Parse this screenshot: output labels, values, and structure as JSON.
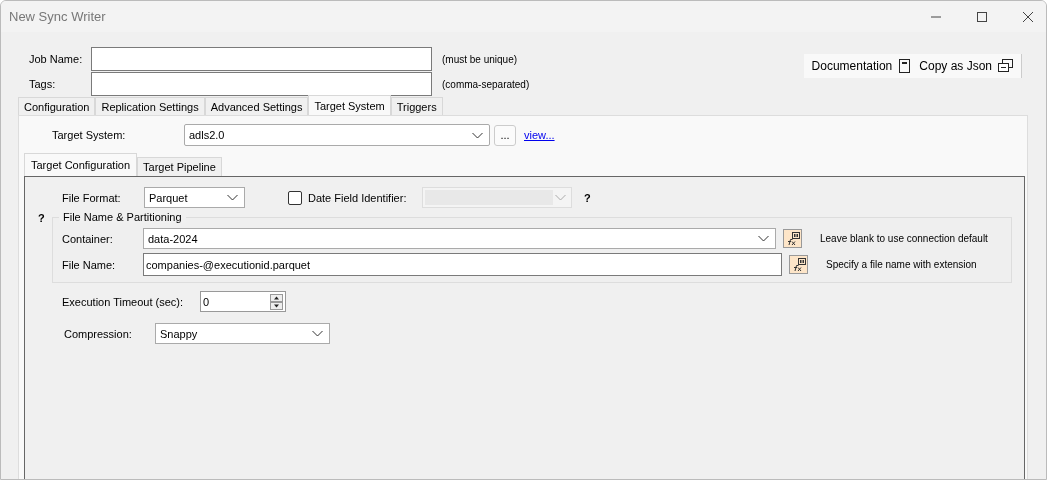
{
  "window": {
    "title": "New Sync Writer"
  },
  "header": {
    "fields": [
      {
        "label": "Job Name:",
        "hint": "(must be unique)"
      },
      {
        "label": "Tags:",
        "hint": "(comma-separated)"
      }
    ],
    "buttons": [
      {
        "label": "Documentation",
        "kind": "doc"
      },
      {
        "label": "Copy as Json",
        "kind": "copy"
      }
    ]
  },
  "tabs": [
    {
      "label": "Configuration",
      "selected": false
    },
    {
      "label": "Replication Settings",
      "selected": false
    },
    {
      "label": "Advanced Settings",
      "selected": false
    },
    {
      "label": "Target System",
      "selected": true
    },
    {
      "label": "Triggers",
      "selected": false
    }
  ],
  "target_system": {
    "label": "Target System:",
    "value": "adls2.0",
    "browse": "...",
    "link": "view..."
  },
  "subtabs": [
    {
      "label": "Target Configuration",
      "selected": true
    },
    {
      "label": "Target Pipeline",
      "selected": false
    }
  ],
  "file_format": {
    "label": "File Format:",
    "value": "Parquet"
  },
  "date_field": {
    "label": "Date Field Identifier:",
    "checked": false,
    "disabled": true,
    "help": "?"
  },
  "group": {
    "help": "?",
    "title": "File Name & Partitioning",
    "rows": [
      {
        "label": "Container:",
        "value": "data-2024",
        "kind": "combo",
        "hint": "Leave blank to use connection default"
      },
      {
        "label": "File Name:",
        "value": "companies-@executionid.parquet",
        "kind": "text",
        "hint": "Specify a file name with extension"
      }
    ]
  },
  "timeout": {
    "label": "Execution Timeout (sec):",
    "value": "0"
  },
  "compression": {
    "label": "Compression:",
    "value": "Snappy"
  }
}
